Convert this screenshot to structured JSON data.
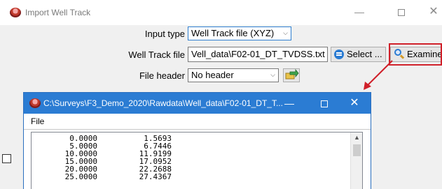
{
  "window": {
    "title": "Import Well Track",
    "controls": {
      "minimize": "—",
      "close": "✕"
    }
  },
  "form": {
    "input_type": {
      "label": "Input type",
      "value": "Well Track file (XYZ)"
    },
    "well_track_file": {
      "label": "Well Track file",
      "value": "Vell_data\\F02-01_DT_TVDSS.txt",
      "select_button": "Select ...",
      "examine_button": "Examine"
    },
    "file_header": {
      "label": "File header",
      "value": "No header"
    }
  },
  "icons": {
    "app": "app-logo-icon",
    "select": "select-list-icon",
    "examine": "magnifier-icon",
    "header_action": "arrow-go-icon",
    "annotation_arrow": "red-arrow"
  },
  "colors": {
    "titlebar_active": "#2b7cd3",
    "highlight_frame": "#d0202a",
    "accent": "#2a7bd2"
  },
  "examine_window": {
    "title": "C:\\Surveys\\F3_Demo_2020\\Rawdata\\Well_data\\F02-01_DT_T...",
    "controls": {
      "minimize": "—",
      "close": "✕"
    },
    "menu": [
      "File"
    ],
    "rows": [
      [
        "0.0000",
        "1.5693"
      ],
      [
        "5.0000",
        "6.7446"
      ],
      [
        "10.0000",
        "11.9199"
      ],
      [
        "15.0000",
        "17.0952"
      ],
      [
        "20.0000",
        "22.2688"
      ],
      [
        "25.0000",
        "27.4367"
      ]
    ]
  }
}
